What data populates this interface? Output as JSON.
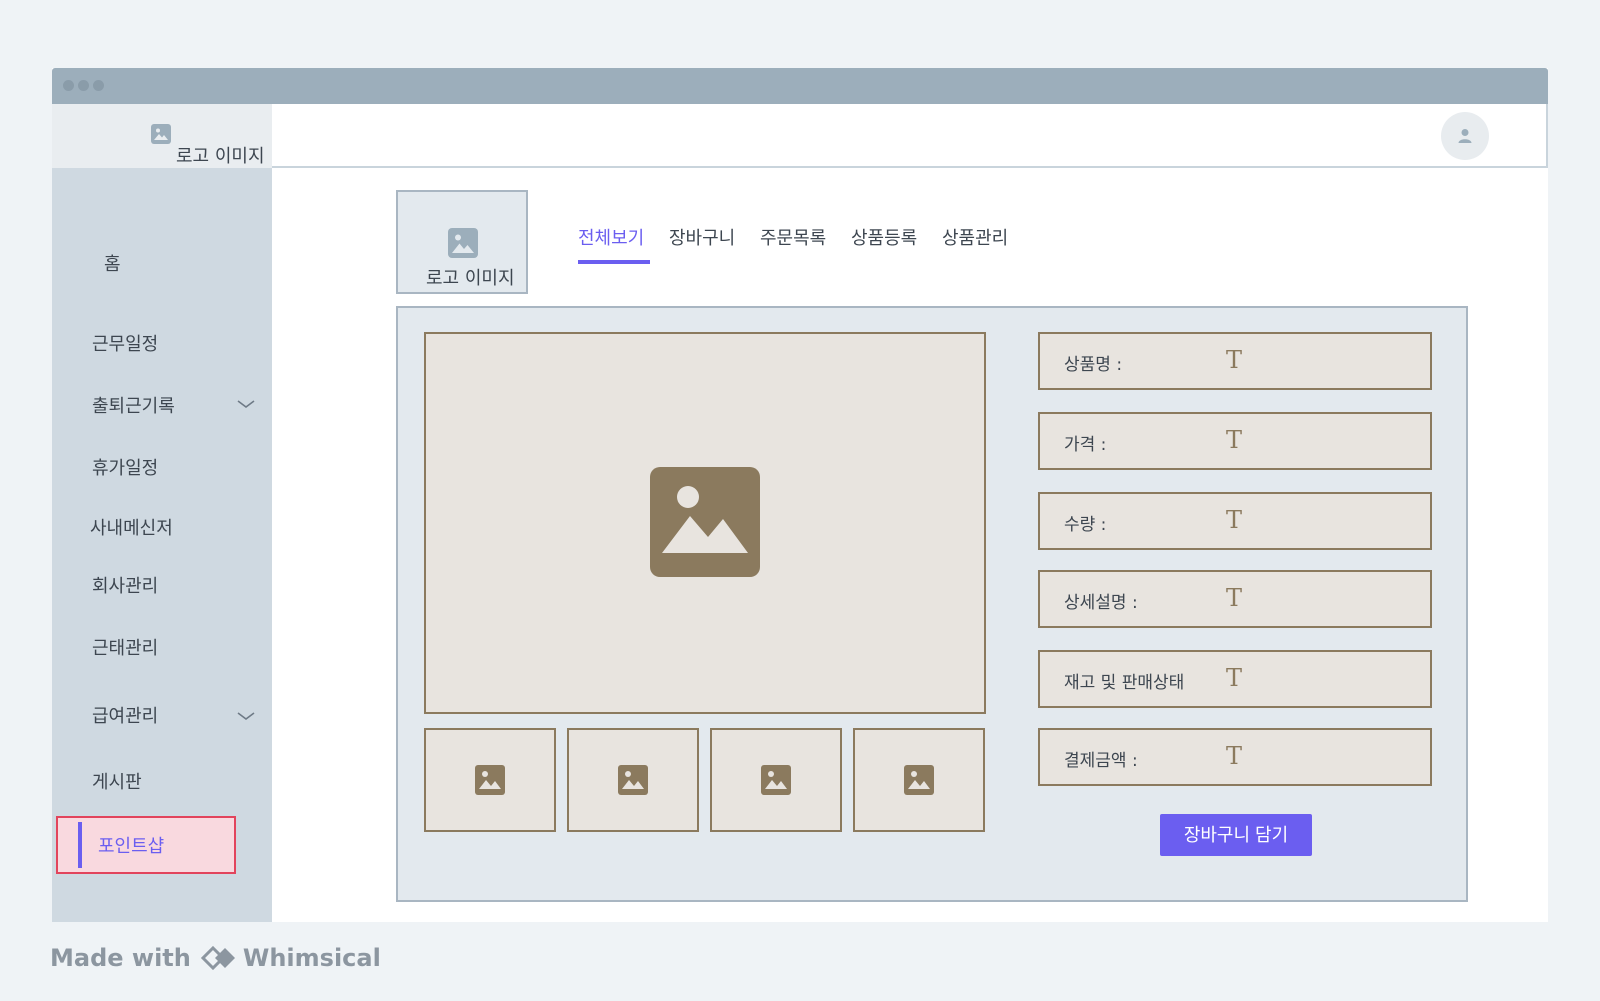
{
  "app": {
    "logo_text": "로고 이미지",
    "accent_color": "#6b5ef0",
    "highlight_color": "#e2445c",
    "placeholder_color": "#8b7a5e"
  },
  "sidebar": {
    "items": [
      {
        "label": "홈",
        "icon": null
      },
      {
        "label": "근무일정"
      },
      {
        "label": "출퇴근기록",
        "icon": "chevron-down-icon"
      },
      {
        "label": "휴가일정"
      },
      {
        "label": "사내메신저"
      },
      {
        "label": "회사관리"
      },
      {
        "label": "근태관리"
      },
      {
        "label": "급여관리",
        "icon": "chevron-down-icon"
      },
      {
        "label": "게시판"
      }
    ],
    "active_item": {
      "label": "포인트샵"
    }
  },
  "header": {
    "avatar_icon": "user-icon"
  },
  "content": {
    "logo_text": "로고 이미지",
    "tabs": [
      {
        "label": "전체보기",
        "active": true
      },
      {
        "label": "장바구니",
        "active": false
      },
      {
        "label": "주문목록",
        "active": false
      },
      {
        "label": "상품등록",
        "active": false
      },
      {
        "label": "상품관리",
        "active": false
      }
    ],
    "product": {
      "fields": [
        {
          "label": "상품명 :",
          "value_glyph": "T"
        },
        {
          "label": "가격 :",
          "value_glyph": "T"
        },
        {
          "label": "수량 :",
          "value_glyph": "T"
        },
        {
          "label": "상세설명 :",
          "value_glyph": "T"
        },
        {
          "label": "재고 및 판매상태",
          "value_glyph": "T"
        },
        {
          "label": "결제금액 :",
          "value_glyph": "T"
        }
      ],
      "add_to_cart_label": "장바구니 담기"
    }
  },
  "footer": {
    "made_with": "Made with",
    "brand": "Whimsical"
  }
}
